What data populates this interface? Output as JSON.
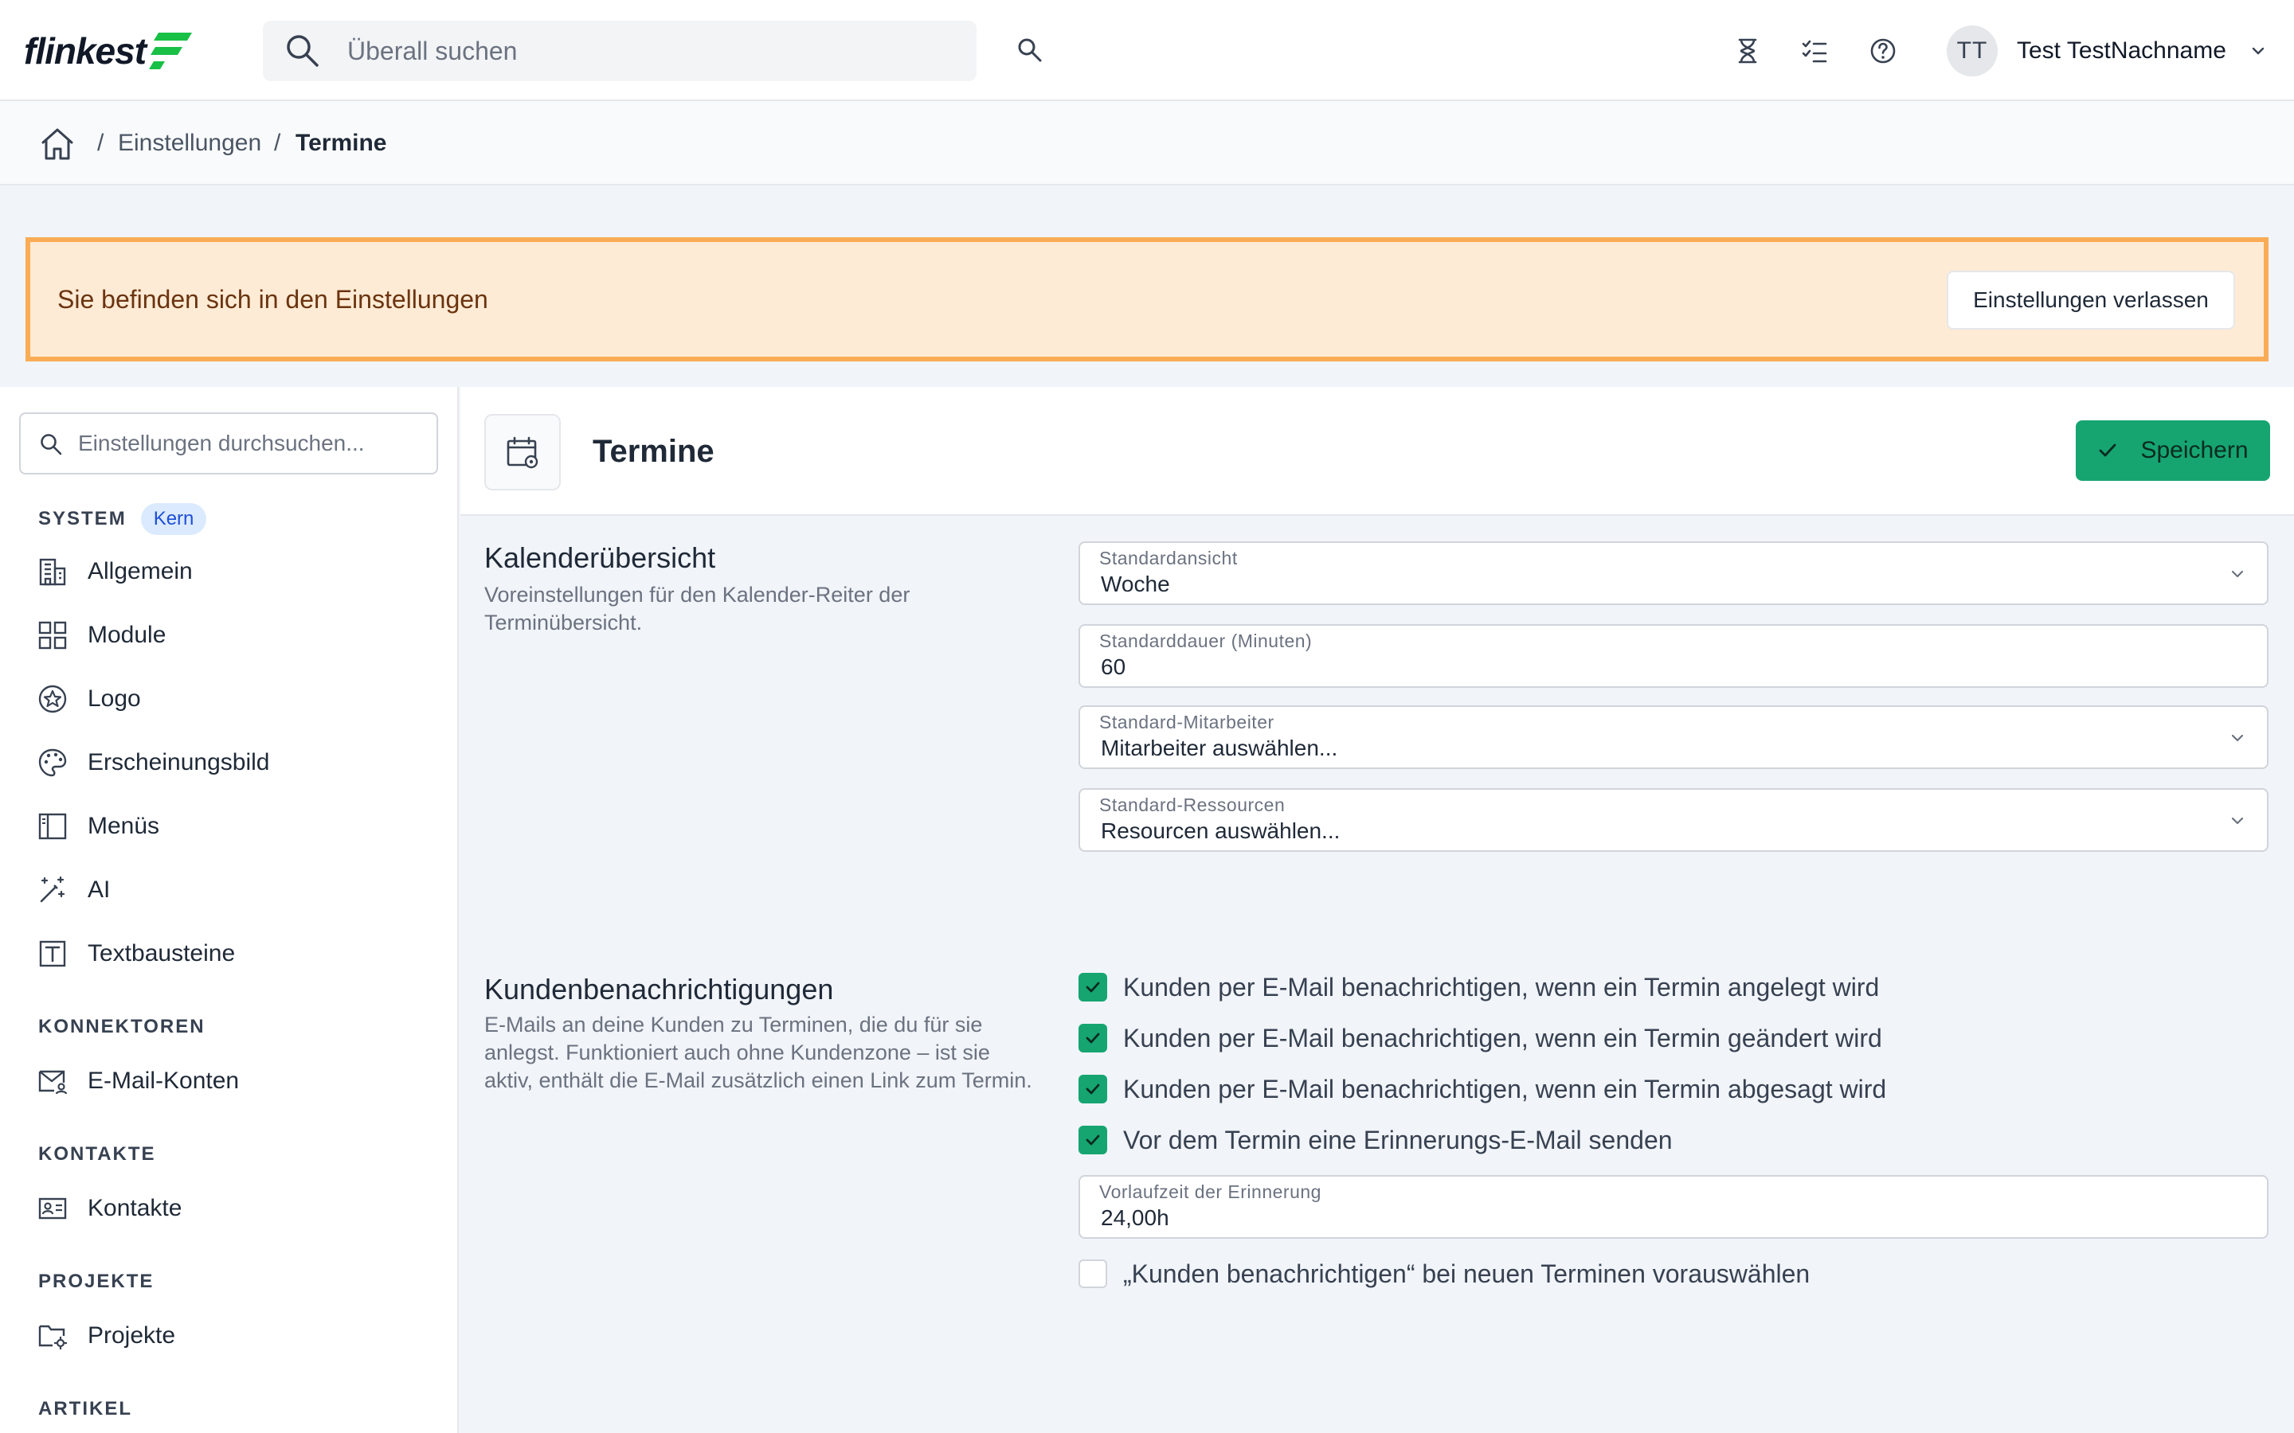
{
  "brand": {
    "name": "flinkest",
    "accent": "#19c046",
    "primary": "#16a571",
    "banner_bg": "#feebd5",
    "banner_border": "#f9ac55"
  },
  "header": {
    "search_placeholder": "Überall suchen",
    "icons": [
      "hourglass-icon",
      "checklist-icon",
      "help-icon"
    ],
    "user": {
      "initials": "TT",
      "name": "Test TestNachname"
    }
  },
  "breadcrumb": {
    "items": [
      "Einstellungen",
      "Termine"
    ],
    "separator": "/"
  },
  "banner": {
    "text": "Sie befinden sich in den Einstellungen",
    "button": "Einstellungen verlassen"
  },
  "sidebar": {
    "search_placeholder": "Einstellungen durchsuchen...",
    "groups": [
      {
        "label": "SYSTEM",
        "badge": "Kern",
        "items": [
          {
            "label": "Allgemein",
            "icon": "building-icon"
          },
          {
            "label": "Module",
            "icon": "grid-icon"
          },
          {
            "label": "Logo",
            "icon": "star-badge-icon"
          },
          {
            "label": "Erscheinungsbild",
            "icon": "palette-icon"
          },
          {
            "label": "Menüs",
            "icon": "sidebar-layout-icon"
          },
          {
            "label": "AI",
            "icon": "magic-wand-icon"
          },
          {
            "label": "Textbausteine",
            "icon": "text-box-icon"
          }
        ]
      },
      {
        "label": "KONNEKTOREN",
        "items": [
          {
            "label": "E-Mail-Konten",
            "icon": "mail-user-icon"
          }
        ]
      },
      {
        "label": "KONTAKTE",
        "items": [
          {
            "label": "Kontakte",
            "icon": "contact-card-icon"
          }
        ]
      },
      {
        "label": "PROJEKTE",
        "items": [
          {
            "label": "Projekte",
            "icon": "folder-gear-icon"
          }
        ]
      },
      {
        "label": "ARTIKEL",
        "items": []
      }
    ]
  },
  "page": {
    "title": "Termine",
    "icon": "calendar-gear-icon",
    "save": "Speichern",
    "sections": [
      {
        "title": "Kalenderübersicht",
        "description": "Voreinstellungen für den Kalender-Reiter der Terminübersicht.",
        "fields": [
          {
            "label": "Standardansicht",
            "value": "Woche",
            "type": "select"
          },
          {
            "label": "Standarddauer (Minuten)",
            "value": "60",
            "type": "input"
          },
          {
            "label": "Standard-Mitarbeiter",
            "value": "Mitarbeiter auswählen...",
            "type": "select"
          },
          {
            "label": "Standard-Ressourcen",
            "value": "Resourcen auswählen...",
            "type": "select"
          }
        ]
      },
      {
        "title": "Kundenbenachrichtigungen",
        "description": "E-Mails an deine Kunden zu Terminen, die du für sie anlegst. Funktioniert auch ohne Kundenzone – ist sie aktiv, enthält die E-Mail zusätzlich einen Link zum Termin.",
        "checkboxes": [
          {
            "label": "Kunden per E-Mail benachrichtigen, wenn ein Termin angelegt wird",
            "checked": true
          },
          {
            "label": "Kunden per E-Mail benachrichtigen, wenn ein Termin geändert wird",
            "checked": true
          },
          {
            "label": "Kunden per E-Mail benachrichtigen, wenn ein Termin abgesagt wird",
            "checked": true
          },
          {
            "label": "Vor dem Termin eine Erinnerungs-E-Mail senden",
            "checked": true
          }
        ],
        "reminder_field": {
          "label": "Vorlaufzeit der Erinnerung",
          "value": "24,00h"
        },
        "preselect_checkbox": {
          "label": "„Kunden benachrichtigen“ bei neuen Terminen vorauswählen",
          "checked": false
        }
      }
    ]
  }
}
